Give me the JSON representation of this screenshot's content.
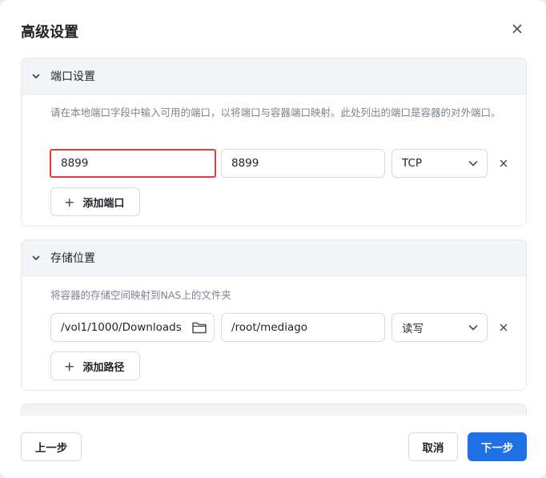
{
  "dialog": {
    "title": "高级设置",
    "close_icon": "close-icon"
  },
  "ports": {
    "title": "端口设置",
    "description": "请在本地端口字段中输入可用的端口，以将端口与容器端口映射。此处列出的端口是容器的对外端口。",
    "rows": [
      {
        "local_port": "8899",
        "container_port": "8899",
        "protocol": "TCP"
      }
    ],
    "add_label": "添加端口"
  },
  "storage": {
    "title": "存储位置",
    "description": "将容器的存储空间映射到NAS上的文件夹",
    "rows": [
      {
        "host_path": "/vol1/1000/Downloads",
        "container_path": "/root/mediago",
        "permission": "读写"
      }
    ],
    "add_label": "添加路径"
  },
  "footer": {
    "prev_label": "上一步",
    "cancel_label": "取消",
    "next_label": "下一步"
  },
  "colors": {
    "primary": "#1f6fe5",
    "highlight_border": "#e23b3b"
  }
}
